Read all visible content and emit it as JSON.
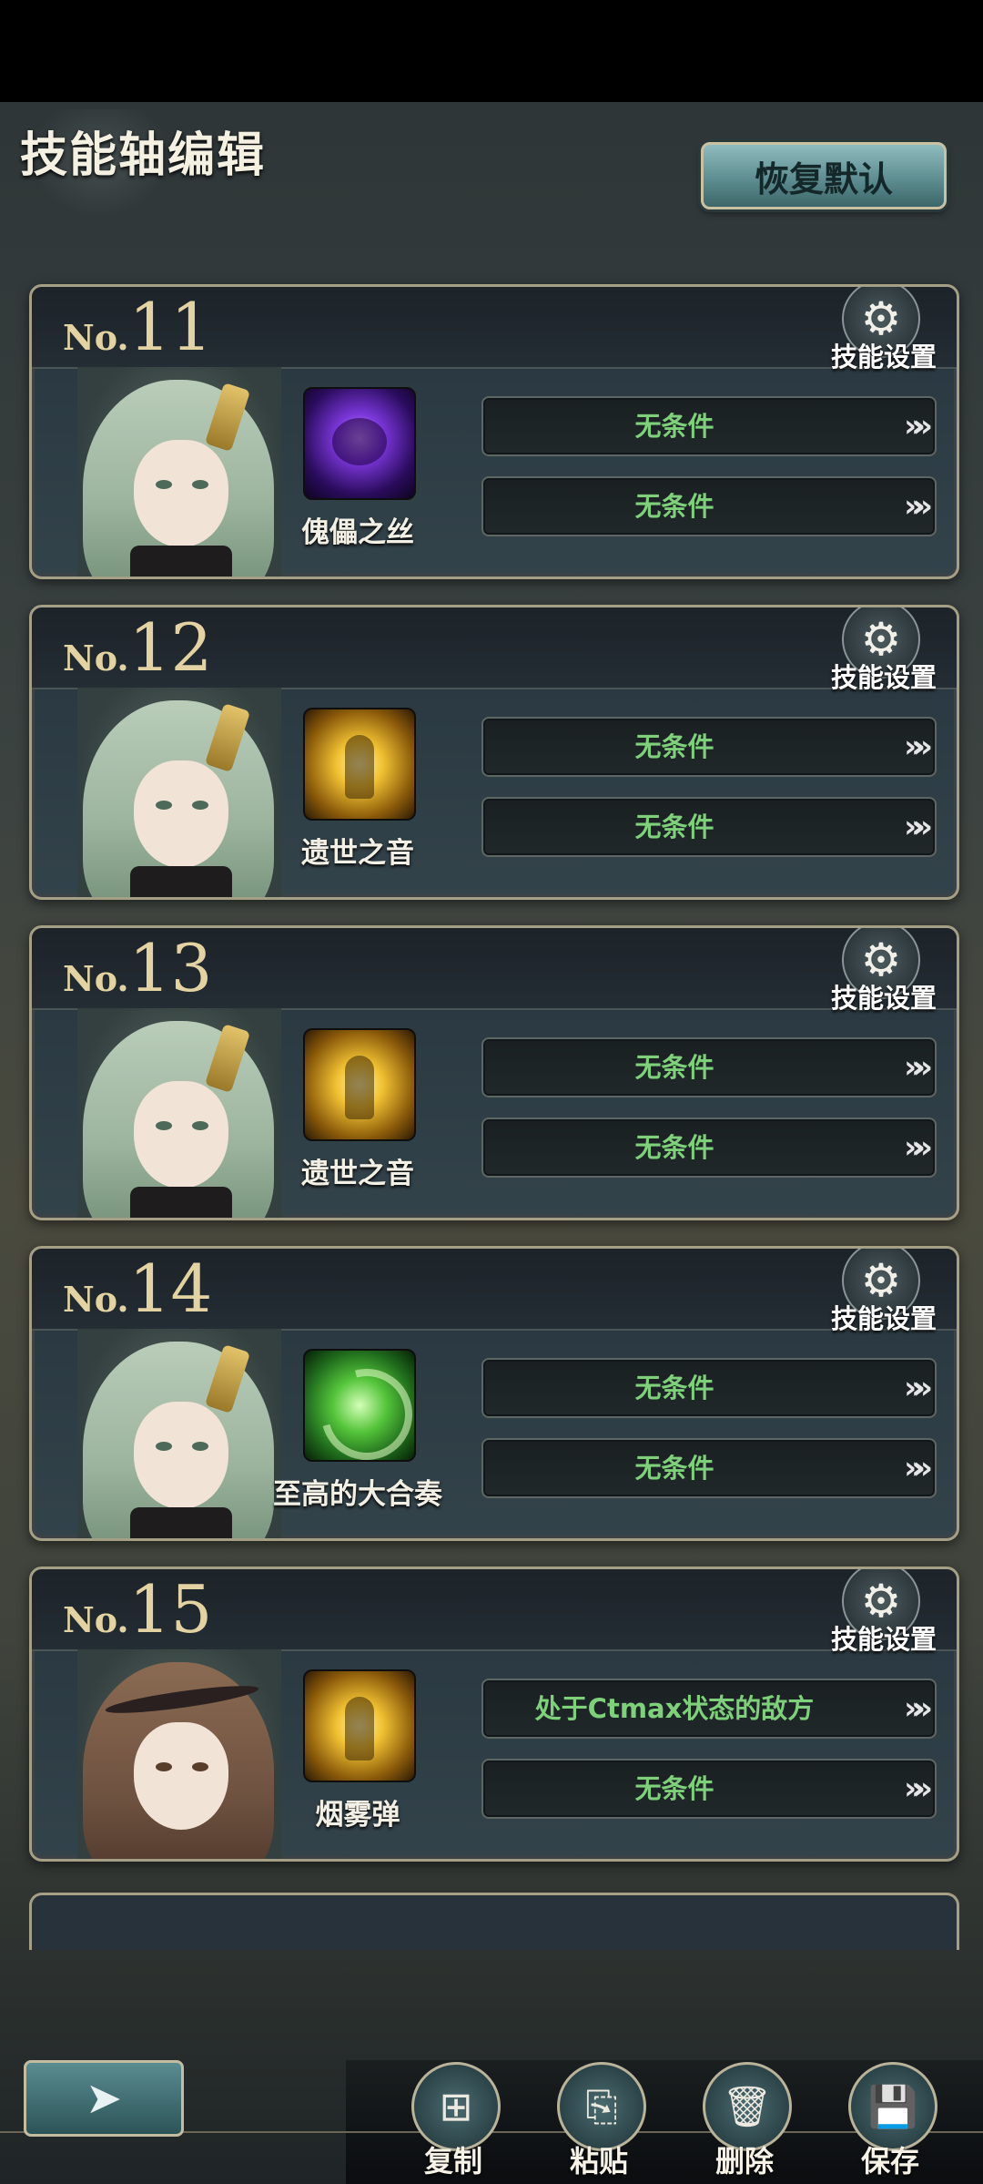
{
  "header": {
    "title": "技能轴编辑",
    "restore_label": "恢复默认"
  },
  "settings_label": "技能设置",
  "cards": [
    {
      "no_prefix": "No.",
      "no": "11",
      "skill": "傀儡之丝",
      "icon": "purple-skull-skill-icon",
      "conditions": [
        "无条件",
        "无条件"
      ]
    },
    {
      "no_prefix": "No.",
      "no": "12",
      "skill": "遗世之音",
      "icon": "golden-figure-skill-icon",
      "conditions": [
        "无条件",
        "无条件"
      ]
    },
    {
      "no_prefix": "No.",
      "no": "13",
      "skill": "遗世之音",
      "icon": "golden-figure-skill-icon",
      "conditions": [
        "无条件",
        "无条件"
      ]
    },
    {
      "no_prefix": "No.",
      "no": "14",
      "skill": "至高的大合奏",
      "icon": "green-tornado-skill-icon",
      "conditions": [
        "无条件",
        "无条件"
      ]
    },
    {
      "no_prefix": "No.",
      "no": "15",
      "skill": "烟雾弹",
      "icon": "golden-figure-skill-icon",
      "conditions": [
        "处于Ctmax状态的敌方",
        "无条件"
      ]
    }
  ],
  "arrow_glyph": "»»",
  "toolbar": {
    "copy": "复制",
    "paste": "粘贴",
    "delete": "删除",
    "save": "保存"
  },
  "colors": {
    "condition_text": "#7ed07a",
    "number_gold": "#e4d3a2",
    "accent_teal": "#5a8a8d"
  }
}
